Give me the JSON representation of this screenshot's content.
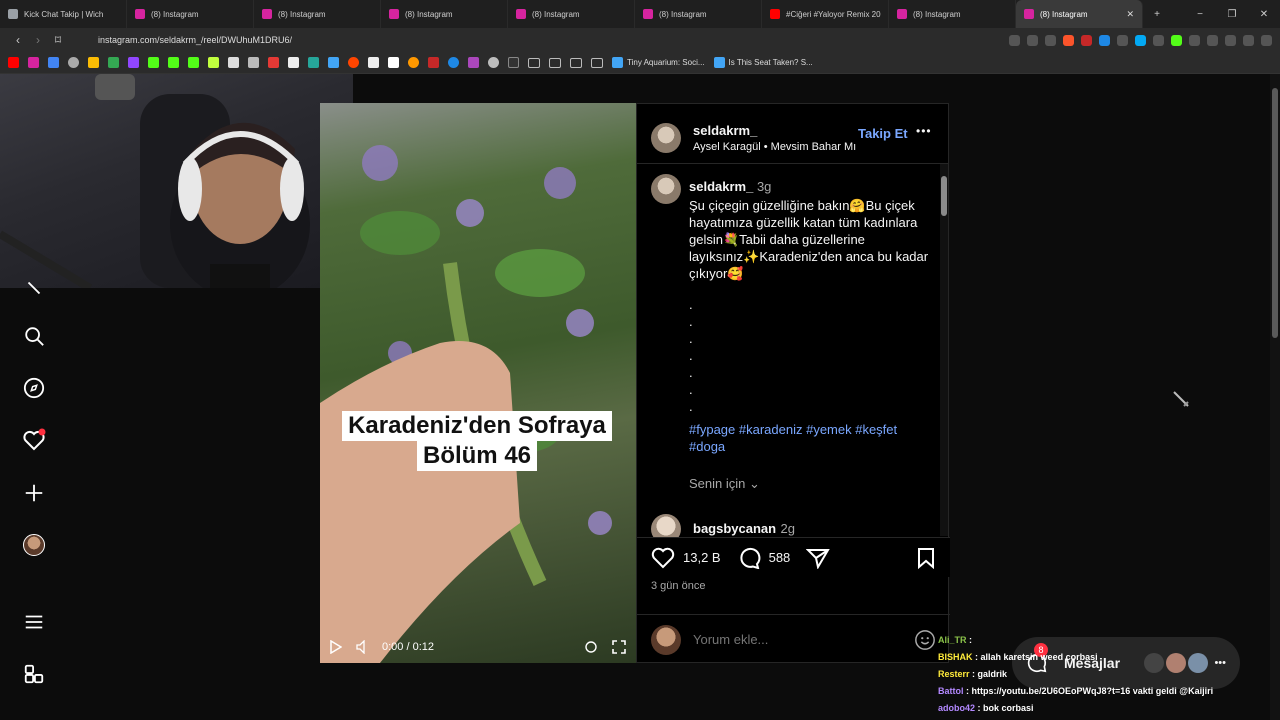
{
  "browser": {
    "tabs": [
      {
        "title": "Kick Chat Takip | Wich",
        "color": "#9aa0a6"
      },
      {
        "title": "(8) Instagram",
        "color": "#d6249f"
      },
      {
        "title": "(8) Instagram",
        "color": "#d6249f"
      },
      {
        "title": "(8) Instagram",
        "color": "#d6249f"
      },
      {
        "title": "(8) Instagram",
        "color": "#d6249f"
      },
      {
        "title": "(8) Instagram",
        "color": "#d6249f"
      },
      {
        "title": "#Ciğeri #Yaloyor Remix 20",
        "color": "#ff0000"
      },
      {
        "title": "(8) Instagram",
        "color": "#d6249f"
      },
      {
        "title": "(8) Instagram",
        "color": "#d6249f",
        "active": true
      }
    ],
    "new_tab": "+",
    "win_min": "−",
    "win_max": "❐",
    "win_close": "✕",
    "url": "instagram.com/seldakrm_/reel/DWUhuM1DRU6/",
    "bookmarks": [
      {
        "label": "Tiny Aquarium: Soci..."
      },
      {
        "label": "Is This Seat Taken? S..."
      }
    ]
  },
  "post": {
    "username": "seldakrm_",
    "audio_artist": "Aysel Karagül",
    "audio_track": "Mevsim Bahar Mı",
    "follow_label": "Takip Et",
    "more_icon": "•••",
    "caption_time": "3g",
    "caption_text": "Şu çiçegin güzelliğine bakın🤗Bu çiçek hayatımıza güzellik katan tüm kadınlara gelsin💐Tabii daha güzellerine layıksınız✨Karadeniz'den anca bu kadar çıkıyor🥰",
    "dots": [
      ".",
      ".",
      ".",
      ".",
      ".",
      ".",
      "."
    ],
    "hashtags_line1": "#fypage #karadeniz #yemek #keşfet",
    "hashtags_line2": "#doga",
    "translate_label": "Senin için",
    "comment_user": "bagsbycanan",
    "comment_time": "2g",
    "likes": "13,2 B",
    "comments": "588",
    "posted_ago": "3 gün önce",
    "comment_placeholder": "Yorum ekle..."
  },
  "video": {
    "title_line1": "Karadeniz'den Sofraya",
    "title_line2": "Bölüm 46",
    "time": "0:00 / 0:12"
  },
  "chat": [
    {
      "user": "Ali_TR",
      "user_color": "#8bc34a",
      "text": ":"
    },
    {
      "user": "BISHAK",
      "user_color": "#ffeb3b",
      "text": ": allah karetsin weed corbasi"
    },
    {
      "user": "Resterr",
      "user_color": "#ffeb3b",
      "text": ": galdrik"
    },
    {
      "user": "Battol",
      "user_color": "#b388ff",
      "text": ": https://youtu.be/2U6OEoPWqJ8?t=16 vakti geldi @Kaijiri"
    },
    {
      "user": "adobo42",
      "user_color": "#b388ff",
      "text": ": bok corbasi"
    }
  ],
  "messages": {
    "label": "Mesajlar",
    "badge": "8"
  },
  "colors": {
    "link": "#7aa7ff",
    "badge": "#ff3040"
  }
}
